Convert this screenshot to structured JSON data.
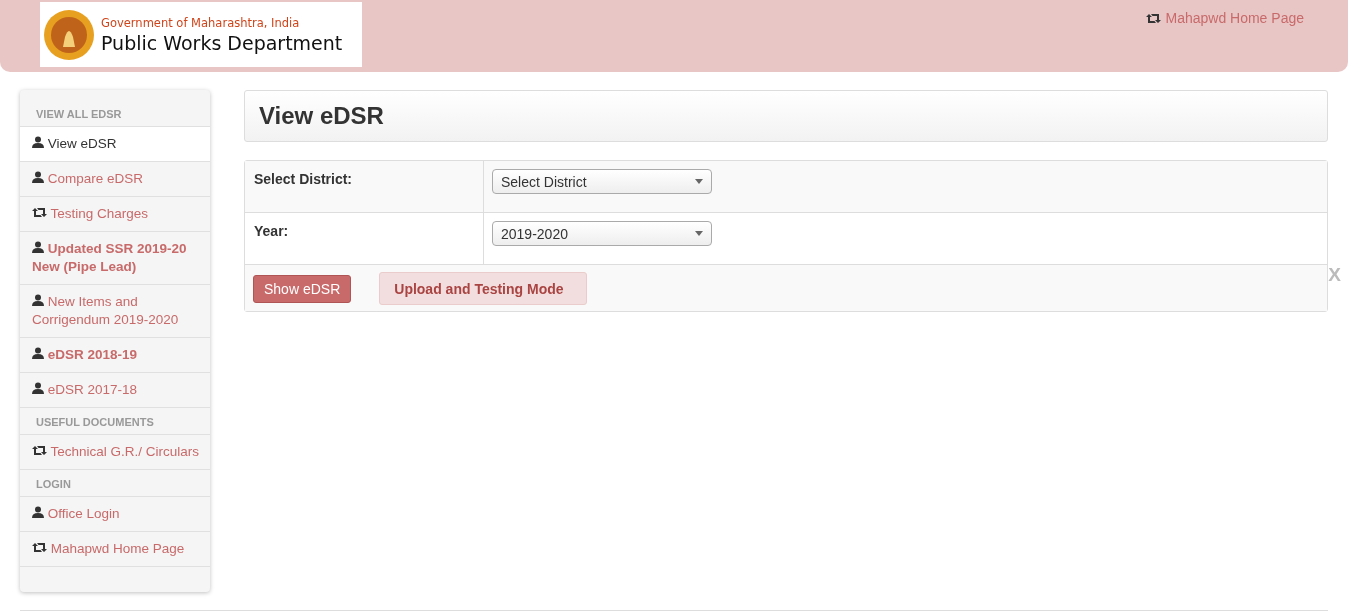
{
  "header": {
    "logo_subtitle": "Government of Maharashtra, India",
    "logo_title": "Public Works Department",
    "home_link": "Mahapwd Home Page"
  },
  "sidebar": [
    {
      "kind": "header",
      "label": "VIEW ALL EDSR"
    },
    {
      "kind": "user",
      "label": "View eDSR",
      "bold": false,
      "selected": true
    },
    {
      "kind": "user",
      "label": "Compare eDSR",
      "bold": false,
      "selected": false
    },
    {
      "kind": "swap",
      "label": "Testing Charges",
      "bold": false,
      "selected": false
    },
    {
      "kind": "user",
      "label": "Updated SSR 2019-20 New (Pipe Lead)",
      "bold": true,
      "selected": false
    },
    {
      "kind": "user",
      "label": "New Items and Corrigendum 2019-2020",
      "bold": false,
      "selected": false
    },
    {
      "kind": "user",
      "label": "eDSR 2018-19",
      "bold": true,
      "selected": false
    },
    {
      "kind": "user",
      "label": "eDSR 2017-18",
      "bold": false,
      "selected": false
    },
    {
      "kind": "header",
      "label": "USEFUL DOCUMENTS"
    },
    {
      "kind": "swap",
      "label": "Technical G.R./ Circulars",
      "bold": false,
      "selected": false
    },
    {
      "kind": "header",
      "label": "LOGIN"
    },
    {
      "kind": "user",
      "label": "Office Login",
      "bold": false,
      "selected": false
    },
    {
      "kind": "swap",
      "label": "Mahapwd Home Page",
      "bold": false,
      "selected": false
    }
  ],
  "page_title": "View eDSR",
  "form": {
    "rows": [
      {
        "label": "Select District:",
        "value": "Select District"
      },
      {
        "label": "Year:",
        "value": "2019-2020"
      }
    ],
    "show_button": "Show eDSR",
    "alert": "Upload and Testing Mode",
    "close": "X"
  }
}
